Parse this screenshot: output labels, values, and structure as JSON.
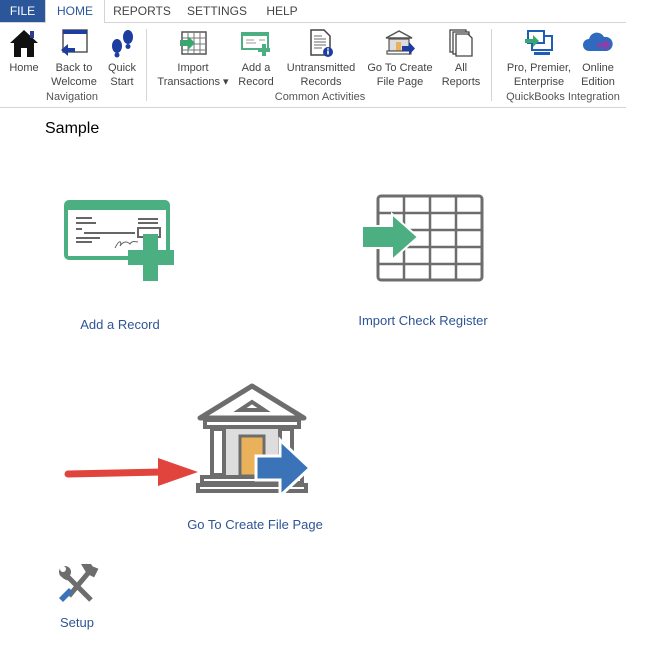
{
  "tabs": [
    {
      "label": "FILE"
    },
    {
      "label": "HOME"
    },
    {
      "label": "REPORTS"
    },
    {
      "label": "SETTINGS"
    },
    {
      "label": "HELP"
    }
  ],
  "ribbon": {
    "groups": [
      {
        "label": "Navigation",
        "buttons": [
          {
            "line1": "Home",
            "line2": "",
            "icon": "home-icon"
          },
          {
            "line1": "Back to",
            "line2": "Welcome",
            "icon": "back-to-welcome-icon"
          },
          {
            "line1": "Quick",
            "line2": "Start",
            "icon": "footprints-icon"
          }
        ]
      },
      {
        "label": "Common Activities",
        "buttons": [
          {
            "line1": "Import",
            "line2": "Transactions ▾",
            "icon": "import-transactions-icon"
          },
          {
            "line1": "Add a",
            "line2": "Record",
            "icon": "add-record-icon"
          },
          {
            "line1": "Untransmitted",
            "line2": "Records",
            "icon": "untransmitted-records-icon"
          },
          {
            "line1": "Go To Create",
            "line2": "File Page",
            "icon": "bank-arrow-icon"
          },
          {
            "line1": "All",
            "line2": "Reports",
            "icon": "all-reports-icon"
          }
        ]
      },
      {
        "label": "QuickBooks Integration",
        "buttons": [
          {
            "line1": "Pro, Premier,",
            "line2": "Enterprise",
            "icon": "desktop-import-icon"
          },
          {
            "line1": "Online",
            "line2": "Edition",
            "icon": "cloud-import-icon"
          }
        ]
      }
    ]
  },
  "main": {
    "title": "Sample",
    "tiles": [
      {
        "label": "Add a Record"
      },
      {
        "label": "Import Check Register"
      },
      {
        "label": "Go To Create File Page"
      },
      {
        "label": "Setup"
      }
    ]
  },
  "colors": {
    "file_tab": "#2b579a",
    "link": "#2f5496",
    "green": "#4caf82",
    "gray_icon": "#6d6d6d",
    "blue_arrow": "#3a73b8",
    "red_arrow": "#e0443c",
    "door": "#e9b25a"
  }
}
